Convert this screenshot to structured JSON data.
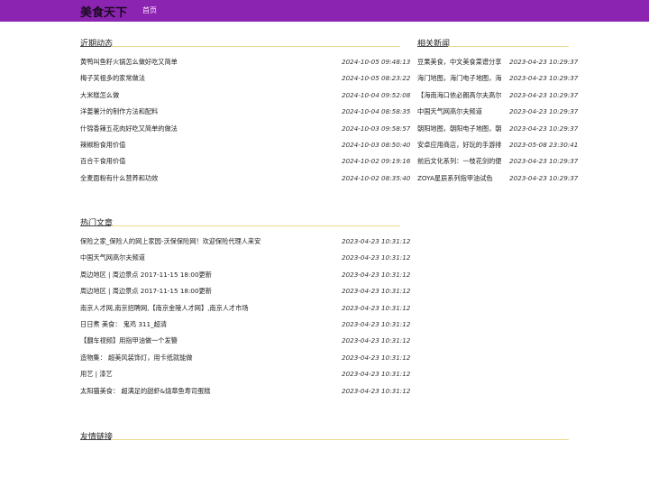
{
  "header": {
    "brand": "美食天下",
    "nav_home": "首页"
  },
  "recent": {
    "title": "近期动态",
    "items": [
      {
        "title": "黄鸭叫鱼籽火锅怎么做好吃又简单",
        "date": "2024-10-05 09:48:13"
      },
      {
        "title": "梅子芙祖多的家常做法",
        "date": "2024-10-05 08:23:22"
      },
      {
        "title": "大米糕怎么做",
        "date": "2024-10-04 09:52:08"
      },
      {
        "title": "洋姜薯汁的制作方法和配料",
        "date": "2024-10-04 08:58:35"
      },
      {
        "title": "什锦香辣五花肉好吃又简单的做法",
        "date": "2024-10-03 09:58:57"
      },
      {
        "title": "辣椒粉食用价值",
        "date": "2024-10-03 08:50:40"
      },
      {
        "title": "百合干食用价值",
        "date": "2024-10-02 09:19:16"
      },
      {
        "title": "全麦面粉有什么营养和功效",
        "date": "2024-10-02 08:35:40"
      }
    ]
  },
  "related": {
    "title": "相关新闻",
    "items": [
      {
        "title": "豆果美食，中文美食菜谱分享",
        "date": "2023-04-23 10:29:37"
      },
      {
        "title": "海门地图，海门电子地图，海",
        "date": "2023-04-23 10:29:37"
      },
      {
        "title": "【海南海口依必朗高尔夫高尔",
        "date": "2023-04-23 10:29:37"
      },
      {
        "title": "中国天气网高尔夫频道",
        "date": "2023-04-23 10:29:37"
      },
      {
        "title": "朝阳地图，朝阳电子地图，朝",
        "date": "2023-04-23 10:29:37"
      },
      {
        "title": "安卓应用商店，好玩的手游排",
        "date": "2023-05-08 23:30:41"
      },
      {
        "title": "前后文化系列：一枝花剑的便",
        "date": "2023-04-23 10:29:37"
      },
      {
        "title": "ZOYA星辰系列指甲油试色",
        "date": "2023-04-23 10:29:37"
      }
    ]
  },
  "hot": {
    "title": "热门文章",
    "items": [
      {
        "title": "保险之家_保险人的网上家园-沃保保险网！欢迎保险代理人来安",
        "date": "2023-04-23 10:31:12"
      },
      {
        "title": "中国天气网高尔夫频道",
        "date": "2023-04-23 10:31:12"
      },
      {
        "title": "周边地区 | 周边景点 2017-11-15 18:00更新",
        "date": "2023-04-23 10:31:12"
      },
      {
        "title": "周边地区 | 周边景点 2017-11-15 18:00更新",
        "date": "2023-04-23 10:31:12"
      },
      {
        "title": "南京人才网,南京招聘网,【南京金陵人才网】,南京人才市场",
        "date": "2023-04-23 10:31:12"
      },
      {
        "title": "日日煮 美食： 鬼鸡 311_超清",
        "date": "2023-04-23 10:31:12"
      },
      {
        "title": "【翻车视频】用指甲油做一个发簪",
        "date": "2023-04-23 10:31:12"
      },
      {
        "title": "造物集： 超美风装饰灯，用卡纸就能做",
        "date": "2023-04-23 10:31:12"
      },
      {
        "title": "用艺 | 漆艺",
        "date": "2023-04-23 10:31:12"
      },
      {
        "title": "太阳猫美食： 超满足的甜虾&烧章鱼寿司蛋糕",
        "date": "2023-04-23 10:31:12"
      }
    ]
  },
  "friends": {
    "title": "友情链接"
  }
}
